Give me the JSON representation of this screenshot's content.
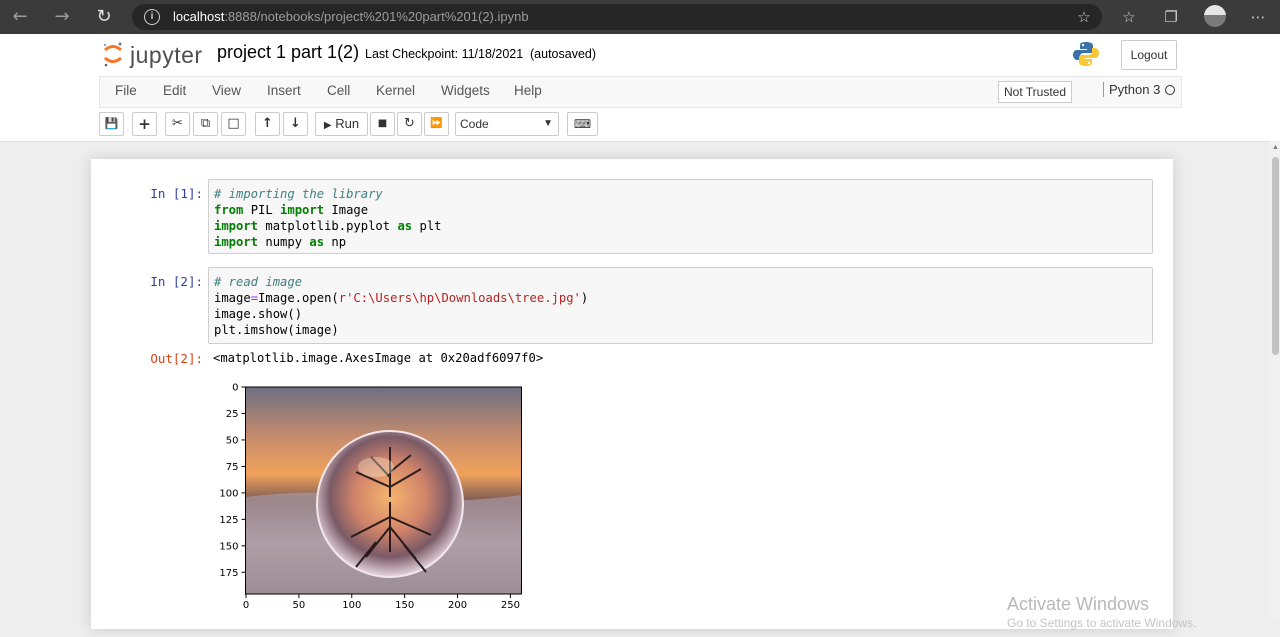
{
  "browser": {
    "url_host": "localhost",
    "url_rest": ":8888/notebooks/project%201%20part%201(2).ipynb"
  },
  "header": {
    "logo_text": "jupyter",
    "notebook_title": "project 1 part 1(2)",
    "checkpoint": "Last Checkpoint: 11/18/2021",
    "autosave": "(autosaved)",
    "logout_label": "Logout"
  },
  "menu": {
    "items": [
      "File",
      "Edit",
      "View",
      "Insert",
      "Cell",
      "Kernel",
      "Widgets",
      "Help"
    ],
    "trust_label": "Not Trusted",
    "kernel_name": "Python 3"
  },
  "toolbar": {
    "run_label": "Run",
    "cell_type": "Code"
  },
  "cells": [
    {
      "prompt": "In [1]:",
      "lines": [
        [
          {
            "t": "# importing the library",
            "c": "cm"
          }
        ],
        [
          {
            "t": "from",
            "c": "kw"
          },
          {
            "t": " PIL ",
            "c": ""
          },
          {
            "t": "import",
            "c": "kw"
          },
          {
            "t": " Image",
            "c": ""
          }
        ],
        [
          {
            "t": "import",
            "c": "kw"
          },
          {
            "t": " matplotlib.pyplot ",
            "c": ""
          },
          {
            "t": "as",
            "c": "kw"
          },
          {
            "t": " plt",
            "c": ""
          }
        ],
        [
          {
            "t": "import",
            "c": "kw"
          },
          {
            "t": " numpy ",
            "c": ""
          },
          {
            "t": "as",
            "c": "kw"
          },
          {
            "t": " np",
            "c": ""
          }
        ]
      ]
    },
    {
      "prompt": "In [2]:",
      "lines": [
        [
          {
            "t": "# read image",
            "c": "cm"
          }
        ],
        [
          {
            "t": "image",
            "c": ""
          },
          {
            "t": "=",
            "c": "op"
          },
          {
            "t": "Image.open(",
            "c": ""
          },
          {
            "t": "r'C:\\Users\\hp\\Downloads\\tree.jpg'",
            "c": "st"
          },
          {
            "t": ")",
            "c": ""
          }
        ],
        [
          {
            "t": "image.show()",
            "c": ""
          }
        ],
        [
          {
            "t": "plt.imshow(image)",
            "c": ""
          }
        ]
      ]
    }
  ],
  "output": {
    "prompt": "Out[2]:",
    "text": "<matplotlib.image.AxesImage at 0x20adf6097f0>"
  },
  "plot": {
    "y_ticks": [
      "0",
      "25",
      "50",
      "75",
      "100",
      "125",
      "150",
      "175"
    ],
    "x_ticks": [
      "0",
      "50",
      "100",
      "150",
      "200",
      "250"
    ]
  },
  "watermark": {
    "title": "Activate Windows",
    "subtitle": "Go to Settings to activate Windows."
  }
}
